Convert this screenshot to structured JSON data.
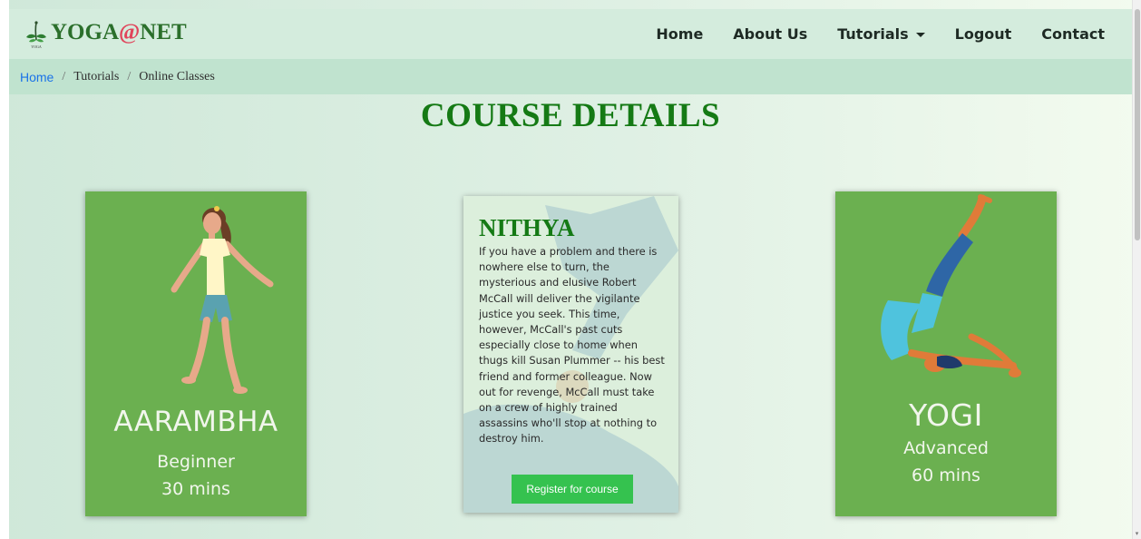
{
  "brand": {
    "name_part1": "YOGA",
    "name_at": "@",
    "name_part2": "NET",
    "logo_caption": "YOGA"
  },
  "nav": {
    "items": [
      {
        "label": "Home"
      },
      {
        "label": "About Us"
      },
      {
        "label": "Tutorials"
      },
      {
        "label": "Logout"
      },
      {
        "label": "Contact"
      }
    ]
  },
  "breadcrumb": {
    "items": [
      "Home",
      "Tutorials",
      "Online Classes"
    ],
    "separator": "/"
  },
  "page": {
    "title": "COURSE DETAILS"
  },
  "courses": [
    {
      "title": "AARAMBHA",
      "level": "Beginner",
      "duration": "30 mins"
    },
    {
      "title": "NITHYA",
      "description": "If you have a problem and there is nowhere else to turn, the mysterious and elusive Robert McCall will deliver the vigilante justice you seek. This time, however, McCall's past cuts especially close to home when thugs kill Susan Plummer -- his best friend and former colleague. Now out for revenge, McCall must take on a crew of highly trained assassins who'll stop at nothing to destroy him.",
      "button_label": "Register for course"
    },
    {
      "title": "YOGI",
      "level": "Advanced",
      "duration": "60 mins"
    }
  ],
  "colors": {
    "card_green": "#6bb050",
    "title_green": "#157a15",
    "button_green": "#35c24f",
    "link_blue": "#1a73e8"
  },
  "icons": {
    "logo": "yoga-plant-icon",
    "dropdown": "caret-down-icon"
  }
}
